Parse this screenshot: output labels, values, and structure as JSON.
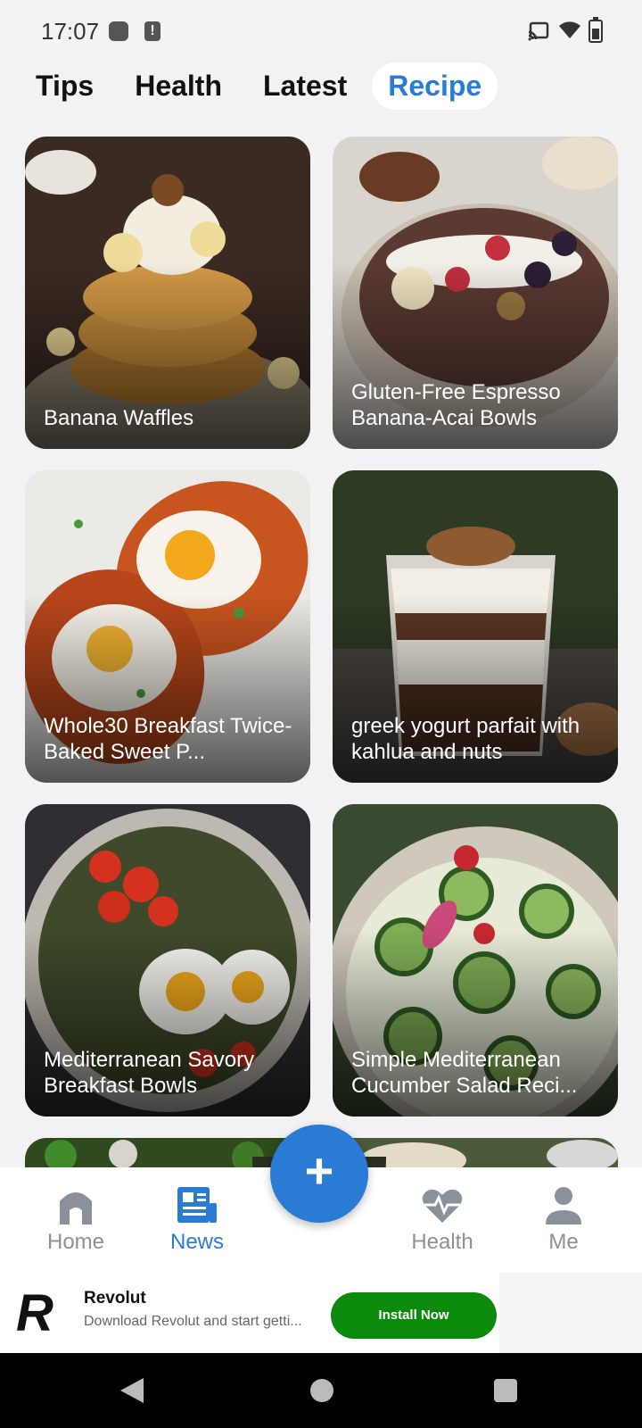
{
  "status_bar": {
    "time": "17:07",
    "icons": [
      "notification-dot-icon",
      "alert-icon",
      "cast-icon",
      "wifi-icon",
      "battery-icon"
    ]
  },
  "tabs": [
    {
      "label": "Tips",
      "active": false
    },
    {
      "label": "Health",
      "active": false
    },
    {
      "label": "Latest",
      "active": false
    },
    {
      "label": "Recipe",
      "active": true
    }
  ],
  "recipes": [
    {
      "title": "Banana Waffles"
    },
    {
      "title": "Gluten-Free Espresso Banana-Acai Bowls"
    },
    {
      "title": "Whole30 Breakfast Twice-Baked Sweet P..."
    },
    {
      "title": "greek yogurt parfait with kahlua and nuts"
    },
    {
      "title": "Mediterranean Savory Breakfast Bowls"
    },
    {
      "title": "Simple Mediterranean Cucumber Salad Reci..."
    }
  ],
  "bottom_nav": {
    "items": [
      {
        "label": "Home",
        "icon": "home-icon",
        "active": false
      },
      {
        "label": "News",
        "icon": "news-icon",
        "active": true
      },
      {
        "label": "Health",
        "icon": "heart-pulse-icon",
        "active": false
      },
      {
        "label": "Me",
        "icon": "person-icon",
        "active": false
      }
    ],
    "fab_label": "+"
  },
  "ad": {
    "logo": "R",
    "title": "Revolut",
    "description": "Download Revolut and start getti...",
    "button_label": "Install Now"
  },
  "colors": {
    "accent": "#2a7bd3",
    "install_button": "#0b8a0b",
    "background": "#f2f2f4"
  }
}
